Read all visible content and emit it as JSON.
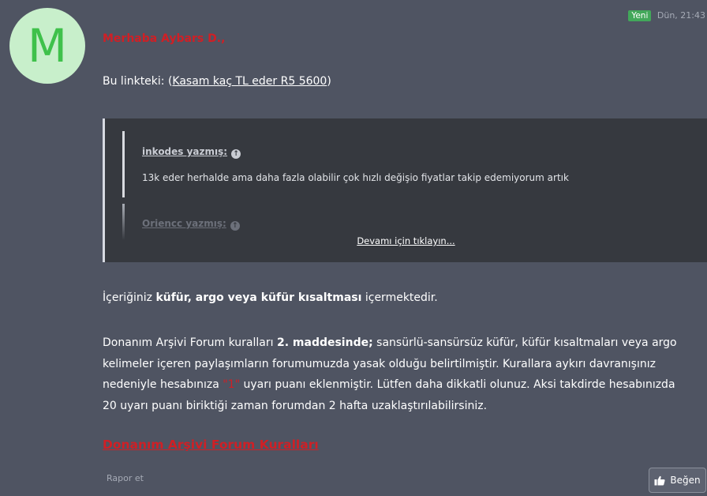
{
  "post": {
    "avatar_letter": "M",
    "badge": "Yeni",
    "date": "Dün, 21:43",
    "greeting": "Merhaba Aybars D.,",
    "link_prefix": "Bu linkteki: (",
    "link_text": "Kasam kaç TL eder R5 5600",
    "link_suffix": ")"
  },
  "quote": {
    "author1": "inkodes yazmış:",
    "text1": "13k eder herhalde ama daha fazla olabilir çok hızlı değişio fiyatlar takip edemiyorum artık",
    "author2": "Oriencc yazmış:",
    "more": "Devamı için tıklayın..."
  },
  "notice": {
    "p1_pre": "İçeriğiniz ",
    "p1_bold": "küfür, argo veya küfür kısaltması",
    "p1_post": " içermektedir.",
    "p2_pre": "Donanım Arşivi Forum kuralları ",
    "p2_bold": "2. maddesinde;",
    "p2_mid": " sansürlü-sansürsüz küfür, küfür kısaltmaları veya argo kelimeler içeren paylaşımların forumumuzda yasak olduğu belirtilmiştir. Kurallara aykırı davranışınız nedeniyle hesabınıza ",
    "p2_red": "\"1\"",
    "p2_post": " uyarı puanı eklenmiştir. Lütfen daha dikkatli olunuz. Aksi takdirde hesabınızda 20 uyarı puanı biriktiği zaman forumdan 2 hafta uzaklaştırılabilirsiniz.",
    "rules_link": "Donanım Arşivi Forum Kuralları"
  },
  "actions": {
    "report": "Rapor et",
    "like": "Beğen"
  },
  "icons": {
    "goto": "arrow-up-circle-icon",
    "like": "thumbs-up-icon"
  }
}
